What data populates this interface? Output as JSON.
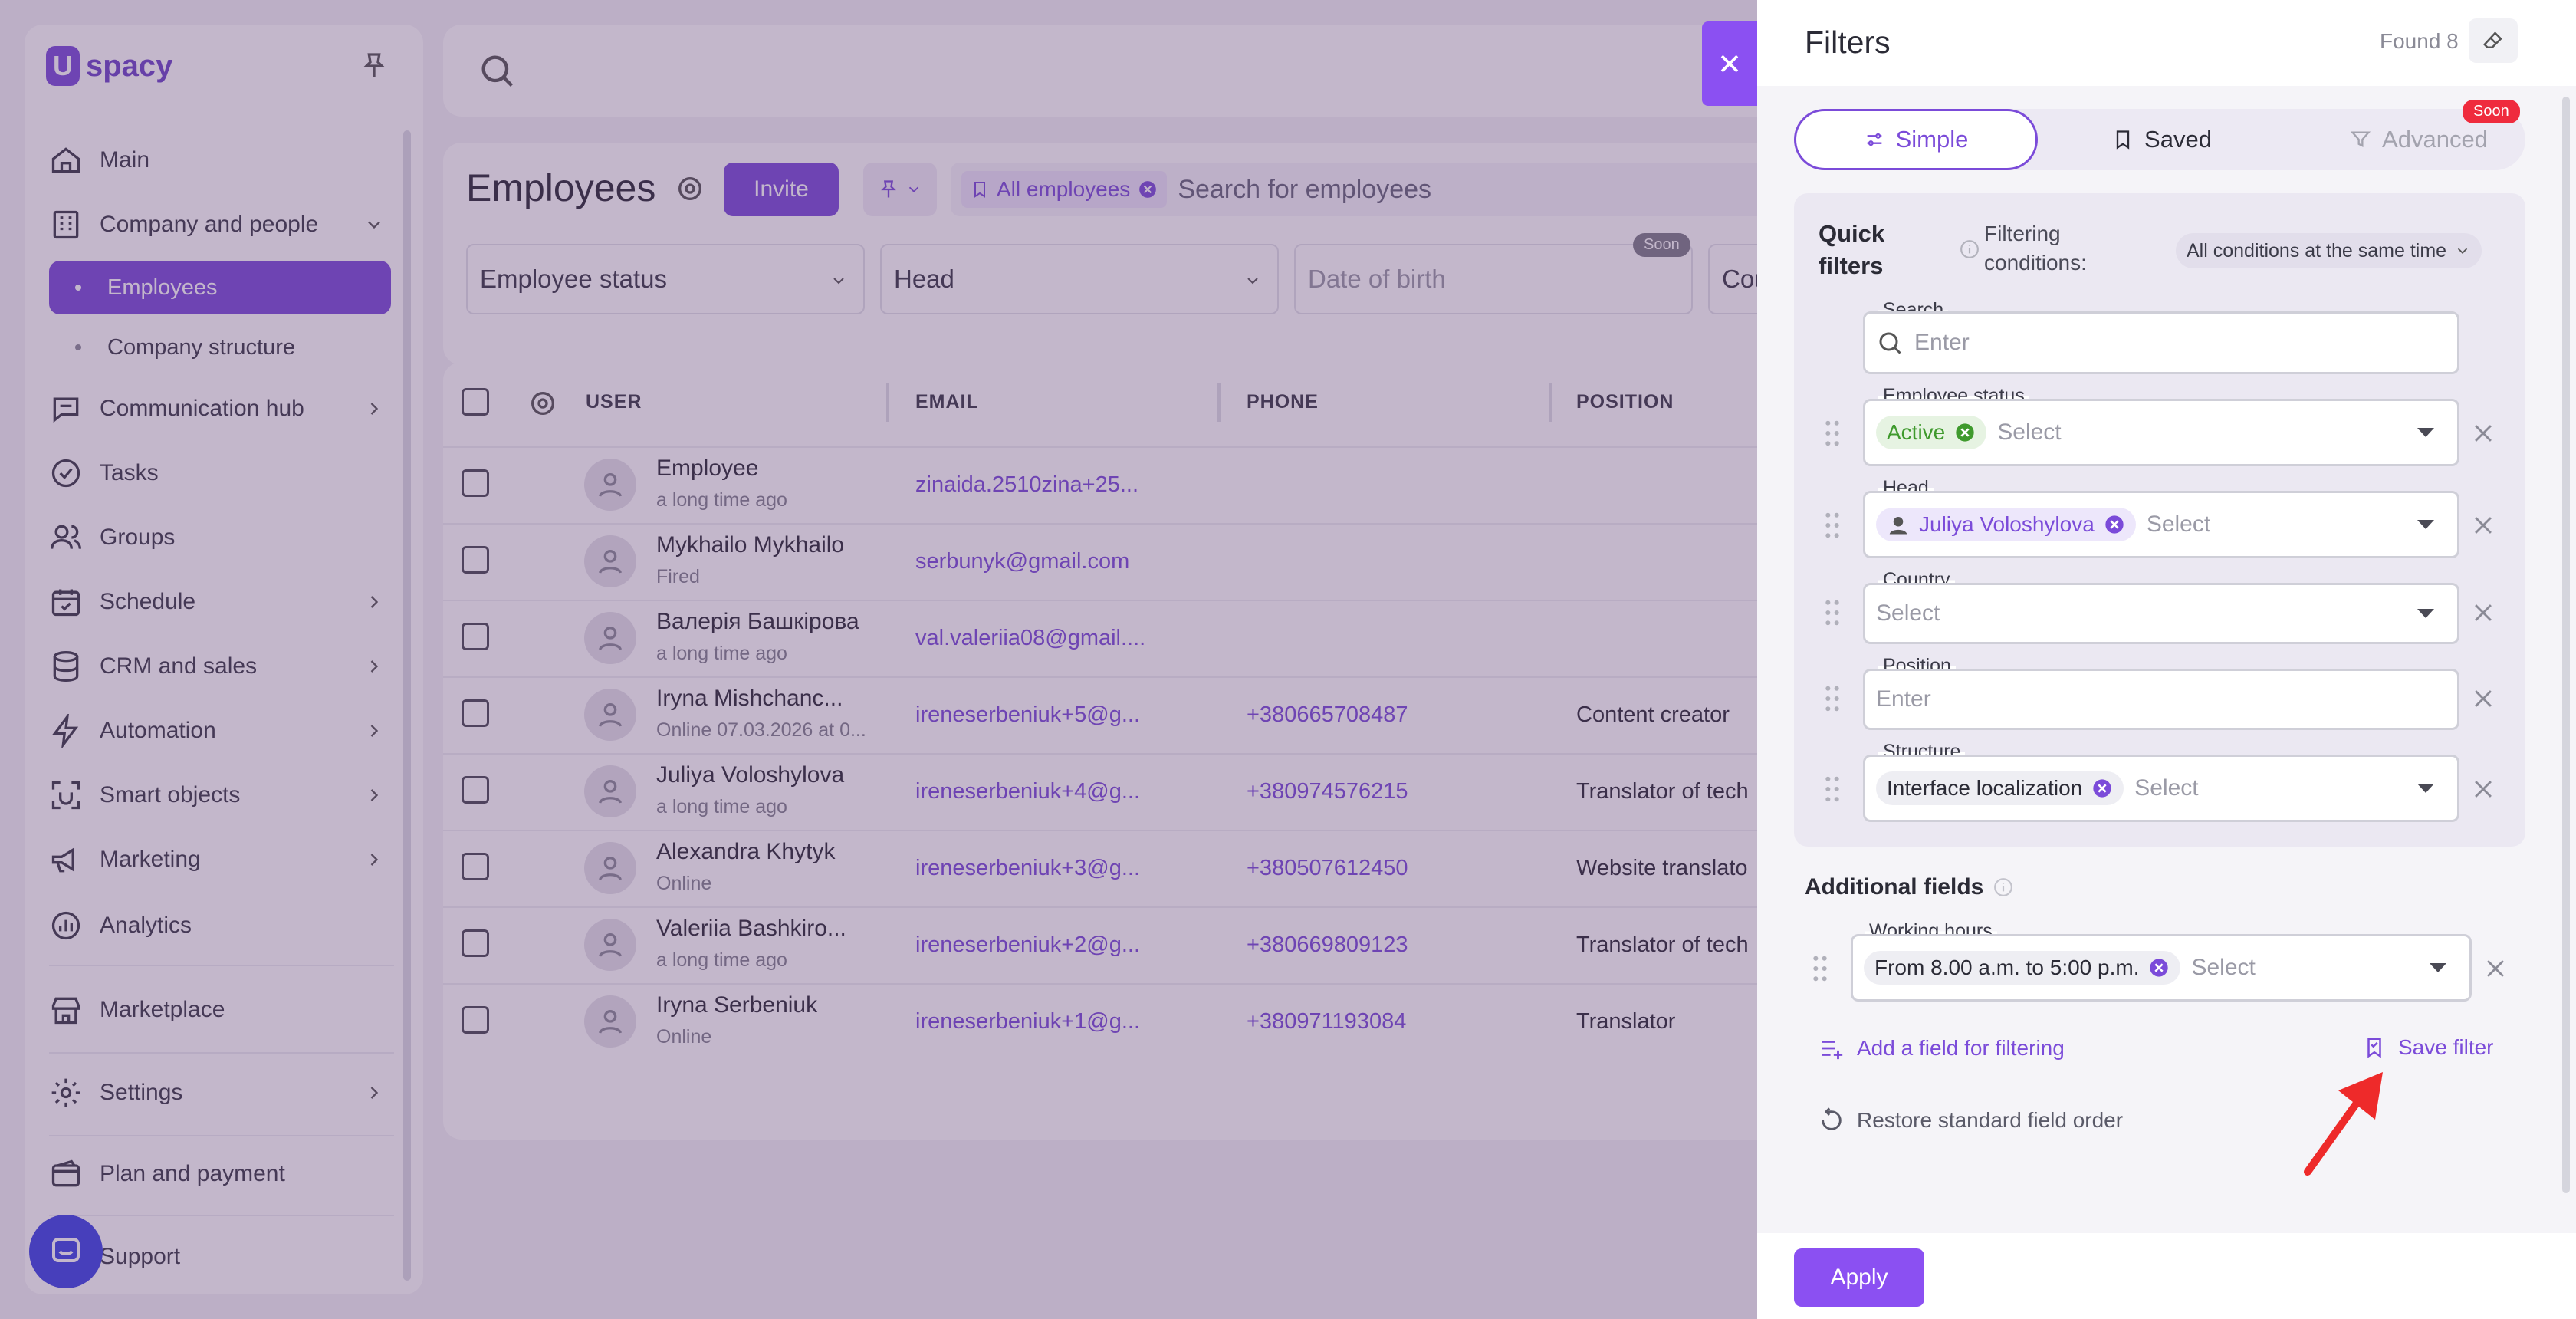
{
  "app": {
    "logo_text": "spacy",
    "logo_letter": "U"
  },
  "sidebar": {
    "items": [
      {
        "label": "Main",
        "icon": "home-icon"
      },
      {
        "label": "Company and people",
        "icon": "building-icon"
      },
      {
        "label": "Employees"
      },
      {
        "label": "Company structure"
      },
      {
        "label": "Communication hub",
        "icon": "chat-icon"
      },
      {
        "label": "Tasks",
        "icon": "check-circle-icon"
      },
      {
        "label": "Groups",
        "icon": "users-icon"
      },
      {
        "label": "Schedule",
        "icon": "calendar-icon"
      },
      {
        "label": "CRM and sales",
        "icon": "database-icon"
      },
      {
        "label": "Automation",
        "icon": "lightning-icon"
      },
      {
        "label": "Smart objects",
        "icon": "scan-icon"
      },
      {
        "label": "Marketing",
        "icon": "marketing-icon"
      },
      {
        "label": "Analytics",
        "icon": "chart-icon"
      },
      {
        "label": "Marketplace",
        "icon": "store-icon"
      },
      {
        "label": "Settings",
        "icon": "gear-icon"
      },
      {
        "label": "Plan and payment",
        "icon": "wallet-icon"
      },
      {
        "label": "Support",
        "icon": "chat-bubble-icon"
      }
    ]
  },
  "page": {
    "title": "Employees",
    "invite_label": "Invite",
    "search_chip": "All employees",
    "search_placeholder": "Search for employees",
    "filters": [
      "Employee status",
      "Head",
      "Date of birth",
      "Cou"
    ],
    "soon": "Soon"
  },
  "table": {
    "columns": [
      "USER",
      "EMAIL",
      "PHONE",
      "POSITION"
    ],
    "rows": [
      {
        "name": "Employee",
        "sub": "a long time ago",
        "email": "zinaida.2510zina+25...",
        "phone": "",
        "position": ""
      },
      {
        "name": "Mykhailo Mykhailo",
        "sub": "Fired",
        "email": "serbunyk@gmail.com",
        "phone": "",
        "position": ""
      },
      {
        "name": "Валерія Башкірова",
        "sub": "a long time ago",
        "email": "val.valeriia08@gmail....",
        "phone": "",
        "position": ""
      },
      {
        "name": "Iryna Mishchanc...",
        "sub": "Online 07.03.2026 at 0...",
        "email": "ireneserbeniuk+5@g...",
        "phone": "+380665708487",
        "position": "Content creator"
      },
      {
        "name": "Juliya Voloshylova",
        "sub": "a long time ago",
        "email": "ireneserbeniuk+4@g...",
        "phone": "+380974576215",
        "position": "Translator of tech"
      },
      {
        "name": "Alexandra Khytyk",
        "sub": "Online",
        "email": "ireneserbeniuk+3@g...",
        "phone": "+380507612450",
        "position": "Website translato"
      },
      {
        "name": "Valeriia Bashkiro...",
        "sub": "a long time ago",
        "email": "ireneserbeniuk+2@g...",
        "phone": "+380669809123",
        "position": "Translator of tech"
      },
      {
        "name": "Iryna Serbeniuk",
        "sub": "Online",
        "email": "ireneserbeniuk+1@g...",
        "phone": "+380971193084",
        "position": "Translator"
      }
    ]
  },
  "drawer": {
    "title": "Filters",
    "found": "Found 8",
    "tabs": {
      "simple": "Simple",
      "saved": "Saved",
      "advanced": "Advanced",
      "soon": "Soon"
    },
    "quick_filters_line1": "Quick",
    "quick_filters_line2": "filters",
    "conditions_line1": "Filtering",
    "conditions_line2": "conditions:",
    "conditions_value": "All conditions at the same time",
    "fields": {
      "search": {
        "label": "Search",
        "placeholder": "Enter"
      },
      "employee_status": {
        "label": "Employee status",
        "chip": "Active",
        "placeholder": "Select"
      },
      "head": {
        "label": "Head",
        "chip": "Juliya Voloshylova",
        "placeholder": "Select"
      },
      "country": {
        "label": "Country",
        "placeholder": "Select"
      },
      "position": {
        "label": "Position",
        "placeholder": "Enter"
      },
      "structure": {
        "label": "Structure",
        "chip": "Interface localization",
        "placeholder": "Select"
      }
    },
    "additional_title": "Additional fields",
    "working_hours": {
      "label": "Working hours",
      "chip": "From 8.00 a.m. to 5:00 p.m.",
      "placeholder": "Select"
    },
    "add_field": "Add a field for filtering",
    "save_filter": "Save filter",
    "restore": "Restore standard field order",
    "apply": "Apply"
  },
  "colors": {
    "accent": "#7b4bd9",
    "green": "#3f9a2d",
    "red": "#ef2b3d"
  }
}
